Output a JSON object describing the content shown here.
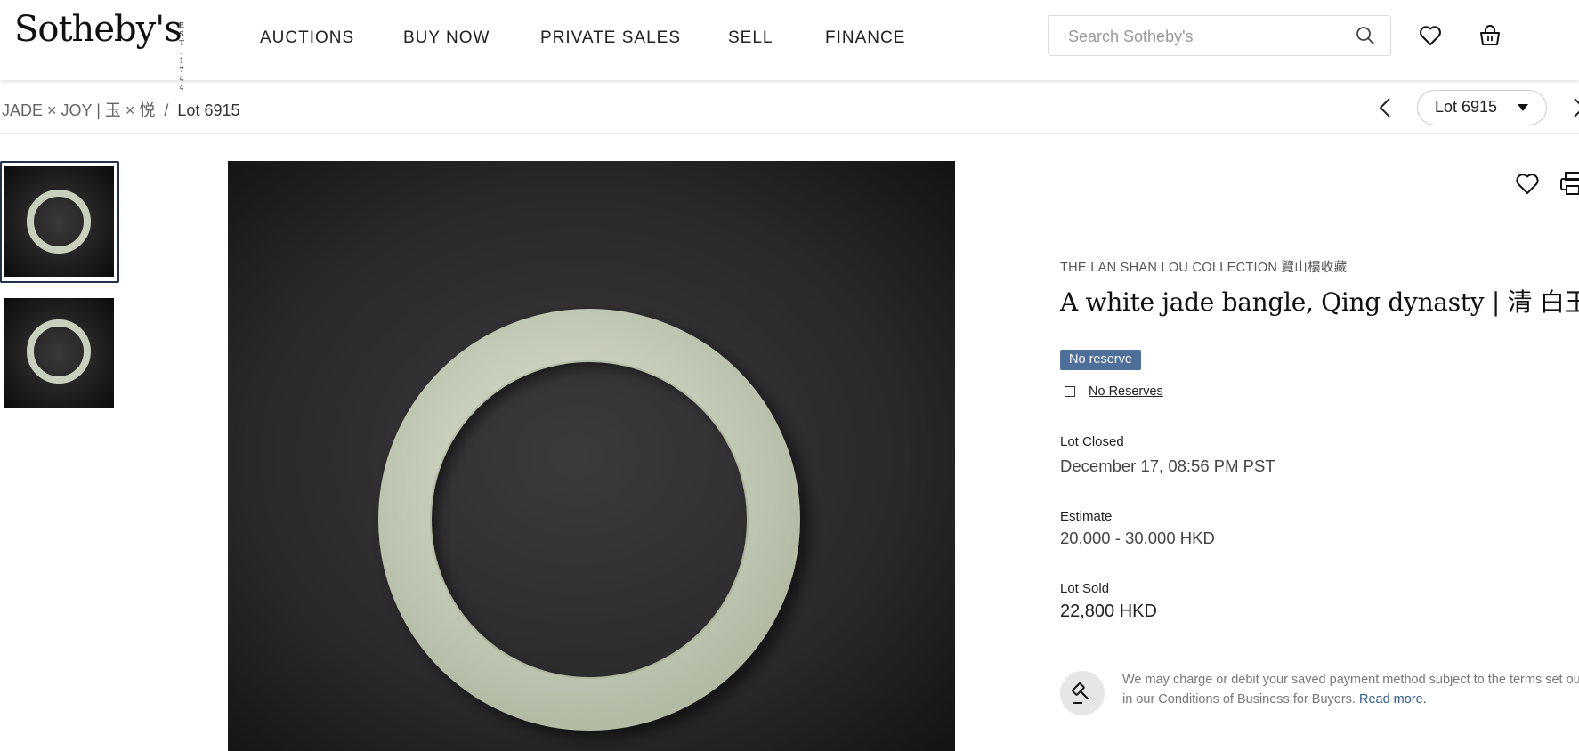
{
  "header": {
    "logo": "Sotheby's",
    "logo_est": "EST. 1744",
    "nav": [
      "AUCTIONS",
      "BUY NOW",
      "PRIVATE SALES",
      "SELL",
      "FINANCE"
    ],
    "search_placeholder": "Search Sotheby's",
    "icons": [
      "search-icon",
      "heart-icon",
      "shopping-bag-icon"
    ]
  },
  "breadcrumb": {
    "sale": "JADE × JOY | 玉 × 悦",
    "separator": "/",
    "current": "Lot 6915"
  },
  "lot_nav": {
    "selected": "Lot 6915"
  },
  "lot": {
    "collection": "THE LAN SHAN LOU COLLECTION 覽山樓收藏",
    "title": "A white jade bangle, Qing dynasty | 清 白玉鐲",
    "badge": "No reserve",
    "no_reserves_link": "No Reserves",
    "closed_label": "Lot Closed",
    "closed_value": "December 17, 08:56 PM PST",
    "estimate_label": "Estimate",
    "estimate_value": "20,000 - 30,000 HKD",
    "sold_label": "Lot Sold",
    "sold_value": "22,800 HKD",
    "terms_text": "We may charge or debit your saved payment method subject to the terms set out in our Conditions of Business for Buyers.",
    "terms_link": "Read more."
  },
  "colors": {
    "badge": "#4d6f9a",
    "link": "#2f5b8a",
    "thumb_border": "#23324a"
  }
}
